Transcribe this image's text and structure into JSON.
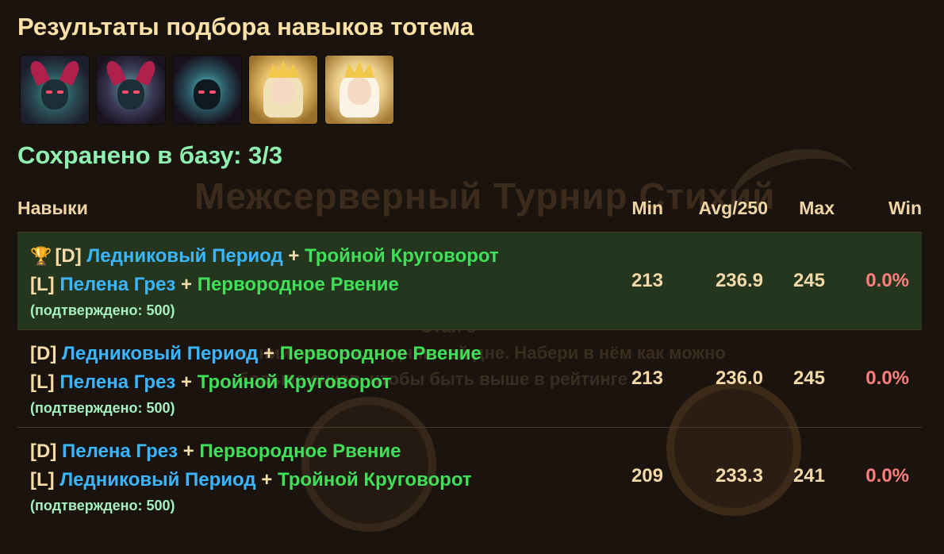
{
  "title": "Результаты подбора навыков тотема",
  "portraits": [
    {
      "icon": "dark-demon-hero-portrait"
    },
    {
      "icon": "dark-horned-hero-portrait"
    },
    {
      "icon": "dark-masked-hero-portrait"
    },
    {
      "icon": "golden-valkyrie-hero-portrait"
    },
    {
      "icon": "golden-angel-hero-portrait"
    }
  ],
  "saved_label": "Сохранено в базу: 3/3",
  "background_text": {
    "heading": "Межсерверный Турнир Стихий",
    "subtitle_1": "Этап 8",
    "subtitle_2": "едний этап в сегодняшней дне. Набери в нём как можно",
    "subtitle_3": "больше очков, чтобы быть выше в рейтинге"
  },
  "table": {
    "headers": {
      "skills": "Навыки",
      "min": "Min",
      "avg": "Avg/250",
      "max": "Max",
      "win": "Win"
    },
    "rows": [
      {
        "best": true,
        "trophy": "🏆",
        "d_tag": "[D]",
        "d_skill_1": "Ледниковый Период",
        "d_plus": "+",
        "d_skill_2": "Тройной Круговорот",
        "l_tag": "[L]",
        "l_skill_1": "Пелена Грез",
        "l_plus": "+",
        "l_skill_2": "Первородное Рвение",
        "confirmed": "(подтверждено: 500)",
        "min": "213",
        "avg": "236.9",
        "max": "245",
        "win": "0.0%"
      },
      {
        "best": false,
        "d_tag": "[D]",
        "d_skill_1": "Ледниковый Период",
        "d_plus": "+",
        "d_skill_2": "Первородное Рвение",
        "l_tag": "[L]",
        "l_skill_1": "Пелена Грез",
        "l_plus": "+",
        "l_skill_2": "Тройной Круговорот",
        "confirmed": "(подтверждено: 500)",
        "min": "213",
        "avg": "236.0",
        "max": "245",
        "win": "0.0%"
      },
      {
        "best": false,
        "d_tag": "[D]",
        "d_skill_1": "Пелена Грез",
        "d_plus": "+",
        "d_skill_2": "Первородное Рвение",
        "l_tag": "[L]",
        "l_skill_1": "Ледниковый Период",
        "l_plus": "+",
        "l_skill_2": "Тройной Круговорот",
        "confirmed": "(подтверждено: 500)",
        "min": "209",
        "avg": "233.3",
        "max": "241",
        "win": "0.0%"
      }
    ]
  },
  "colors": {
    "background": "#1b140e",
    "title": "#fbe1a6",
    "saved": "#8ff0b0",
    "skill_blue": "#39b6ff",
    "skill_green": "#3fe058",
    "win_red": "#ff7d7d",
    "best_row": "#25361f"
  }
}
